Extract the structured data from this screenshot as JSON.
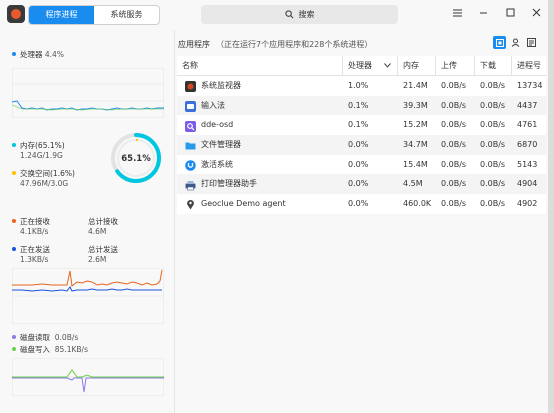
{
  "titlebar": {
    "tabs": [
      {
        "label": "程序进程",
        "active": true
      },
      {
        "label": "系统服务",
        "active": false
      }
    ],
    "search_placeholder": "搜索",
    "window_controls": [
      "menu-icon",
      "minimize-icon",
      "maximize-icon",
      "close-icon"
    ]
  },
  "sidebar": {
    "cpu": {
      "label": "处理器",
      "value": "4.4%",
      "color": "#1a8cf0"
    },
    "memory": {
      "mem_label": "内存(65.1%)",
      "mem_value": "1.24G/1.9G",
      "mem_color": "#00c7e1",
      "swap_label": "交换空间(1.6%)",
      "swap_value": "47.96M/3.0G",
      "swap_color": "#fec200",
      "gauge_text": "65.1%",
      "gauge_percent": 65.1
    },
    "network": {
      "recv_label": "正在接收",
      "recv_value": "4.1KB/s",
      "total_recv_label": "总计接收",
      "total_recv_value": "4.6M",
      "send_label": "正在发送",
      "send_value": "1.3KB/s",
      "total_send_label": "总计发送",
      "total_send_value": "2.6M",
      "recv_color": "#e8651a",
      "send_color": "#1a52e0"
    },
    "disk": {
      "read_label": "磁盘读取",
      "read_value": "0.0B/s",
      "read_color": "#8a7ee8",
      "write_label": "磁盘写入",
      "write_value": "85.1KB/s",
      "write_color": "#6ed04a"
    }
  },
  "main": {
    "title": "应用程序",
    "subtitle": "（正在运行7个应用程序和228个系统进程）",
    "view_buttons": [
      "app-view-icon",
      "user-view-icon",
      "all-view-icon"
    ],
    "columns": [
      "名称",
      "处理器",
      "内存",
      "上传",
      "下载",
      "进程号"
    ],
    "rows": [
      {
        "name": "系统监视器",
        "cpu": "1.0%",
        "mem": "21.4M",
        "up": "0.0B/s",
        "down": "0.0B/s",
        "pid": "13734",
        "icon": "system-monitor-icon",
        "icon_color": "#d04a20"
      },
      {
        "name": "输入法",
        "cpu": "0.1%",
        "mem": "39.3M",
        "up": "0.0B/s",
        "down": "0.0B/s",
        "pid": "4437",
        "icon": "keyboard-icon",
        "icon_color": "#3d6fd8"
      },
      {
        "name": "dde-osd",
        "cpu": "0.1%",
        "mem": "15.2M",
        "up": "0.0B/s",
        "down": "0.0B/s",
        "pid": "4761",
        "icon": "osd-icon",
        "icon_color": "#7b5be8"
      },
      {
        "name": "文件管理器",
        "cpu": "0.0%",
        "mem": "34.7M",
        "up": "0.0B/s",
        "down": "0.0B/s",
        "pid": "6870",
        "icon": "folder-icon",
        "icon_color": "#2a9ae8"
      },
      {
        "name": "激活系统",
        "cpu": "0.0%",
        "mem": "15.4M",
        "up": "0.0B/s",
        "down": "0.0B/s",
        "pid": "5143",
        "icon": "activation-icon",
        "icon_color": "#1a8cf0"
      },
      {
        "name": "打印管理器助手",
        "cpu": "0.0%",
        "mem": "4.5M",
        "up": "0.0B/s",
        "down": "0.0B/s",
        "pid": "4904",
        "icon": "printer-icon",
        "icon_color": "#3c5a8a"
      },
      {
        "name": "Geoclue Demo agent",
        "cpu": "0.0%",
        "mem": "460.0K",
        "up": "0.0B/s",
        "down": "0.0B/s",
        "pid": "4902",
        "icon": "location-pin-icon",
        "icon_color": "#444444"
      }
    ]
  }
}
